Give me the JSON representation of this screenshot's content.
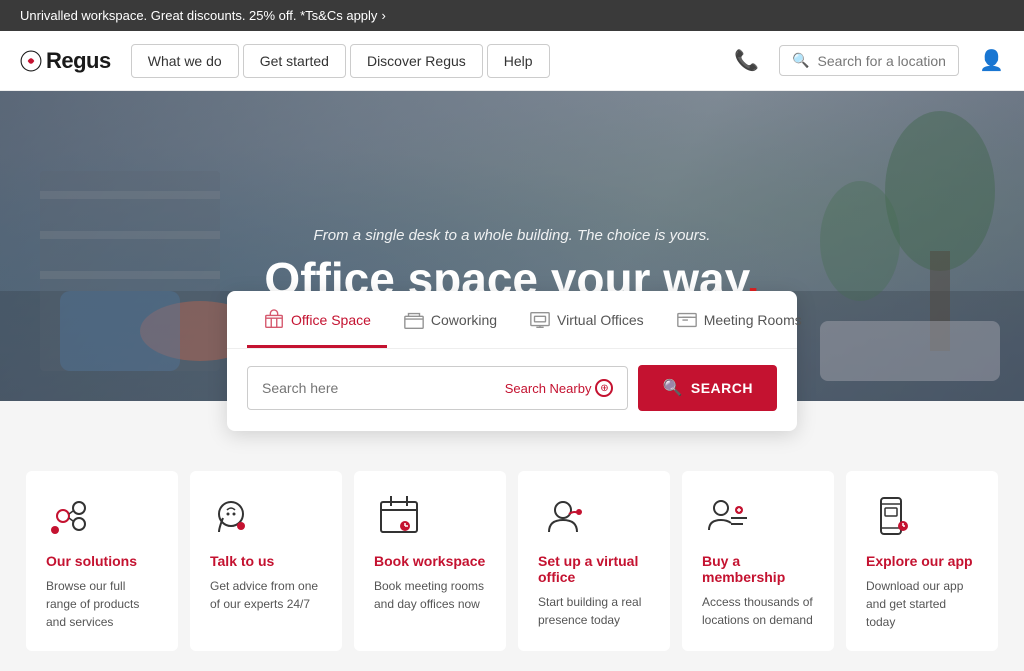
{
  "banner": {
    "text": "Unrivalled workspace. Great discounts. 25% off. *Ts&Cs apply",
    "arrow": "›"
  },
  "header": {
    "logo": "Regus",
    "nav": [
      {
        "label": "What we do"
      },
      {
        "label": "Get started"
      },
      {
        "label": "Discover Regus"
      },
      {
        "label": "Help"
      }
    ],
    "search_placeholder": "Search for a location"
  },
  "hero": {
    "subtitle": "From a single desk to a whole building. The choice is yours.",
    "title": "Office space your way",
    "dot": "."
  },
  "search_card": {
    "tabs": [
      {
        "label": "Office Space",
        "active": true
      },
      {
        "label": "Coworking",
        "active": false
      },
      {
        "label": "Virtual Offices",
        "active": false
      },
      {
        "label": "Meeting Rooms",
        "active": false
      }
    ],
    "input_placeholder": "Search here",
    "nearby_label": "Search Nearby",
    "search_button": "SEARCH"
  },
  "cards": [
    {
      "link": "Our solutions",
      "desc": "Browse our full range of products and services"
    },
    {
      "link": "Talk to us",
      "desc": "Get advice from one of our experts 24/7"
    },
    {
      "link": "Book workspace",
      "desc": "Book meeting rooms and day offices now"
    },
    {
      "link": "Set up a virtual office",
      "desc": "Start building a real presence today"
    },
    {
      "link": "Buy a membership",
      "desc": "Access thousands of locations on demand"
    },
    {
      "link": "Explore our app",
      "desc": "Download our app and get started today"
    }
  ]
}
